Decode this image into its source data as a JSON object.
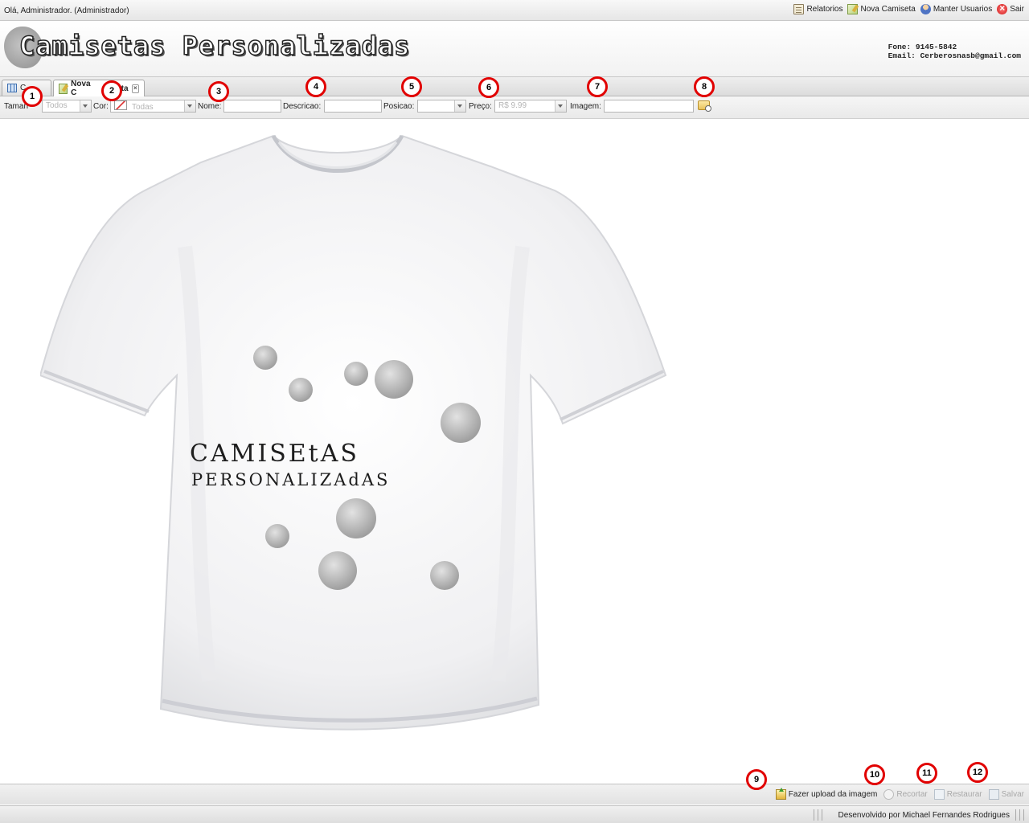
{
  "topbar": {
    "greeting": "Olá, Administrador. (Administrador)",
    "nav": [
      {
        "label": "Relatorios",
        "icon": "report-icon"
      },
      {
        "label": "Nova Camiseta",
        "icon": "edit-icon"
      },
      {
        "label": "Manter Usuarios",
        "icon": "user-icon"
      },
      {
        "label": "Sair",
        "icon": "exit-icon"
      }
    ]
  },
  "header": {
    "logo_text": "Camisetas Personalizadas",
    "phone": "Fone: 9145-5842",
    "email": "Email: Cerberosnasb@gmail.com"
  },
  "tabs": [
    {
      "label": "C",
      "active": false
    },
    {
      "label": "Nova C",
      "label_tail": "ta",
      "active": true
    }
  ],
  "filters": {
    "tamanho_label": "Taman",
    "tamanho_value": "Todos",
    "cor_label": "Cor:",
    "cor_value": "Todas",
    "nome_label": "Nome:",
    "descricao_label": "Descricao:",
    "posicao_label": "Posicao:",
    "preco_label": "Preço:",
    "preco_value": "R$ 9.99",
    "imagem_label": "Imagem:"
  },
  "shirt": {
    "line1": "CAMISEtAS",
    "line2": "PERSONALIZAdAS"
  },
  "actions": [
    {
      "label": "Fazer upload da imagem",
      "enabled": true
    },
    {
      "label": "Recortar",
      "enabled": false
    },
    {
      "label": "Restaurar",
      "enabled": false
    },
    {
      "label": "Salvar",
      "enabled": false
    }
  ],
  "status": {
    "credits": "Desenvolvido por Michael Fernandes Rodrigues"
  },
  "markers": [
    "1",
    "2",
    "3",
    "4",
    "5",
    "6",
    "7",
    "8",
    "9",
    "10",
    "11",
    "12"
  ],
  "colors": {
    "marker_ring": "#e10000",
    "disabled_text": "#a8a8a8"
  }
}
